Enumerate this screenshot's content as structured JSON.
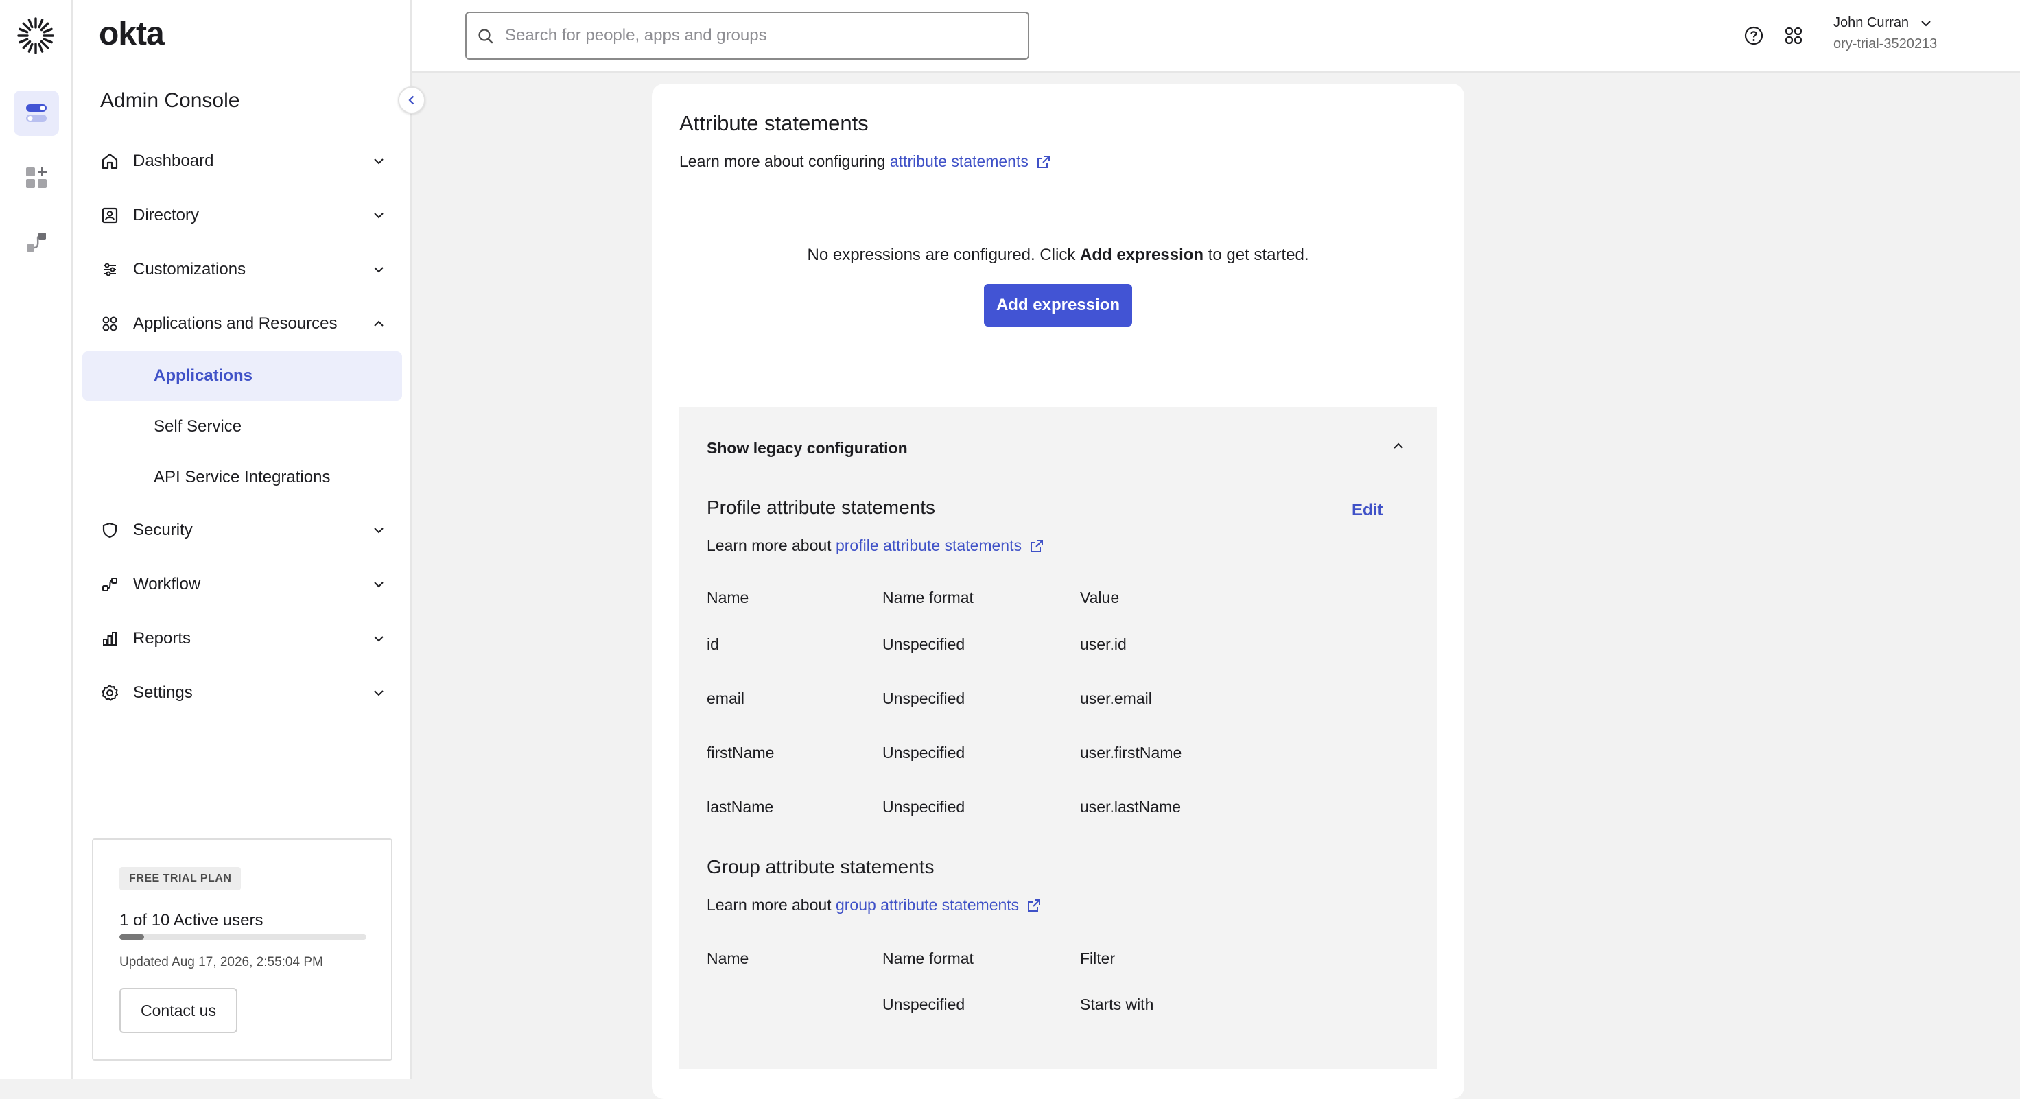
{
  "brand": {
    "wordmark": "okta",
    "console_title": "Admin Console"
  },
  "rail": {
    "icons": [
      "toggle-icon",
      "add-apps-icon",
      "workflow-icon"
    ]
  },
  "sidebar": {
    "items": [
      {
        "label": "Dashboard",
        "icon": "home-icon",
        "expanded": false
      },
      {
        "label": "Directory",
        "icon": "directory-icon",
        "expanded": false
      },
      {
        "label": "Customizations",
        "icon": "sliders-icon",
        "expanded": false
      },
      {
        "label": "Applications and Resources",
        "icon": "apps-icon",
        "expanded": true
      },
      {
        "label": "Security",
        "icon": "shield-icon",
        "expanded": false
      },
      {
        "label": "Workflow",
        "icon": "workflow-icon",
        "expanded": false
      },
      {
        "label": "Reports",
        "icon": "reports-icon",
        "expanded": false
      },
      {
        "label": "Settings",
        "icon": "gear-icon",
        "expanded": false
      }
    ],
    "subitems": [
      {
        "label": "Applications",
        "active": true
      },
      {
        "label": "Self Service",
        "active": false
      },
      {
        "label": "API Service Integrations",
        "active": false
      }
    ]
  },
  "trial": {
    "badge": "FREE TRIAL PLAN",
    "users": "1 of 10 Active users",
    "usage_fraction": 0.1,
    "updated": "Updated Aug 17, 2026, 2:55:04 PM",
    "contact_label": "Contact us"
  },
  "topbar": {
    "search_placeholder": "Search for people, apps and groups",
    "user_name": "John Curran",
    "user_org": "ory-trial-3520213"
  },
  "attributes": {
    "title": "Attribute statements",
    "learn_prefix": "Learn more about configuring",
    "learn_link": "attribute statements",
    "empty_pre": "No expressions are configured. Click",
    "empty_bold": "Add expression",
    "empty_post": "to get started.",
    "add_button": "Add expression"
  },
  "legacy": {
    "toggle_label": "Show legacy configuration",
    "profile": {
      "title": "Profile attribute statements",
      "edit_label": "Edit",
      "learn_prefix": "Learn more about",
      "learn_link": "profile attribute statements",
      "columns": [
        "Name",
        "Name format",
        "Value"
      ],
      "rows": [
        [
          "id",
          "Unspecified",
          "user.id"
        ],
        [
          "email",
          "Unspecified",
          "user.email"
        ],
        [
          "firstName",
          "Unspecified",
          "user.firstName"
        ],
        [
          "lastName",
          "Unspecified",
          "user.lastName"
        ]
      ]
    },
    "group": {
      "title": "Group attribute statements",
      "learn_prefix": "Learn more about",
      "learn_link": "group attribute statements",
      "columns": [
        "Name",
        "Name format",
        "Filter"
      ],
      "rows": [
        [
          "",
          "Unspecified",
          "Starts with"
        ]
      ]
    }
  },
  "colors": {
    "accent": "#4254d4",
    "link": "#3f51c7",
    "active_bg": "#eceefb"
  }
}
